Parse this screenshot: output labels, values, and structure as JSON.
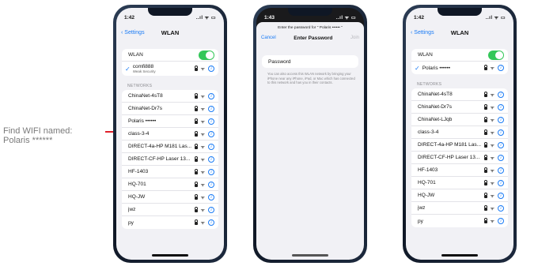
{
  "annotation": {
    "line1": "Find WIFI named:",
    "line2": "Polaris ******",
    "arrow_color": "#e0202a"
  },
  "accent": "#1a7bf5",
  "toggle_color": "#34c759",
  "phone1": {
    "time": "1:42",
    "signal": "..ıl ᯤ ▭",
    "back": "Settings",
    "title": "WLAN",
    "wlan_label": "WLAN",
    "connected": {
      "name": "comfi888",
      "sub": "Weak Security"
    },
    "section": "NETWORKS",
    "networks": [
      "ChinaNet-4sT8",
      "ChinaNet-Dr7s",
      "Polaris ••••••",
      "class-3-4",
      "DIRECT-4a-HP M181 Las...",
      "DIRECT-CF-HP Laser 13...",
      "HF-1403",
      "HQ-701",
      "HQ-JW",
      "jwz",
      "py"
    ]
  },
  "phone2": {
    "time": "1:43",
    "signal": "..ıl ᯤ ▭",
    "prompt": "Enter the password for \" Polaris •••••• \"",
    "cancel": "Cancel",
    "title": "Enter Password",
    "join": "Join",
    "password_label": "Password",
    "note": "You can also access this WLAN network by bringing your iPhone near any iPhone, iPad, or Mac which has connected to this network and has you in their contacts."
  },
  "phone3": {
    "time": "1:42",
    "signal": "..ıl ᯤ ▭",
    "back": "Settings",
    "title": "WLAN",
    "wlan_label": "WLAN",
    "connected": {
      "name": "Polaris ••••••"
    },
    "section": "NETWORKS",
    "networks": [
      "ChinaNet-4sT8",
      "ChinaNet-Dr7s",
      "ChinaNet-LJqb",
      "class-3-4",
      "DIRECT-4a-HP M181 Las...",
      "DIRECT-CF-HP Laser 13...",
      "HF-1403",
      "HQ-701",
      "HQ-JW",
      "jwz",
      "py"
    ]
  },
  "icons": {
    "lock": "lock-icon",
    "wifi": "wifi-icon",
    "info": "info-icon",
    "check": "checkmark-icon",
    "back": "chevron-left-icon"
  }
}
